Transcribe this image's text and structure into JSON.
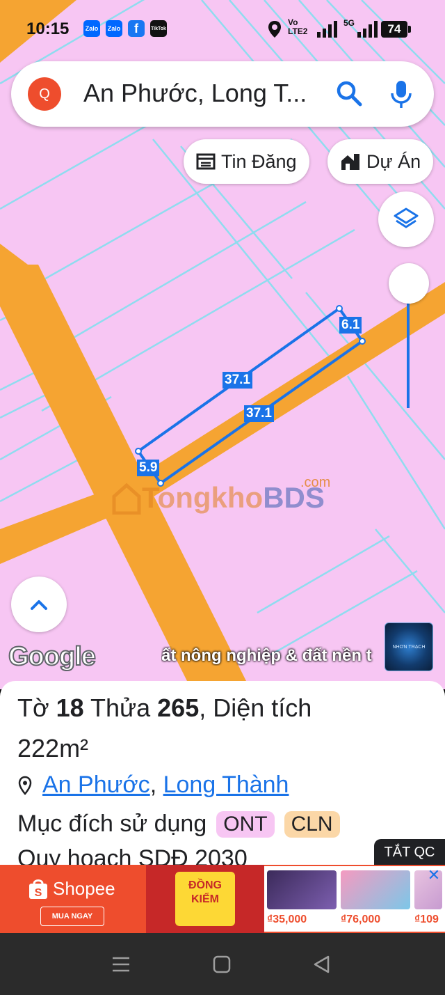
{
  "status_bar": {
    "time": "10:15",
    "apps": [
      "Zalo",
      "Zalo",
      "f",
      "TikTok"
    ],
    "network_left": "Vo LTE2",
    "network_right": "5G",
    "battery": "74"
  },
  "search": {
    "text": "An Phước, Long T...",
    "logo_letter": "Q"
  },
  "chips": {
    "listings": "Tin Đăng",
    "projects": "Dự Án"
  },
  "map": {
    "measurements": [
      "6.1",
      "37.1",
      "37.1",
      "5.9"
    ],
    "watermark_left": "Tongkho",
    "watermark_right": "BDS",
    "watermark_com": ".com",
    "google": "Google",
    "caption": "ất nông nghiệp & đất nền t",
    "thumbnail_text": "NHƠN TRẠCH"
  },
  "sheet": {
    "line1": {
      "a": "Tờ ",
      "b": "18",
      "c": " Thửa ",
      "d": "265",
      "e": ", Diện tích"
    },
    "area": "222m²",
    "ward": "An Phước",
    "separator": ",",
    "district": "Long Thành",
    "usage_label": "Mục đích sử dụng",
    "tags": [
      "ONT",
      "CLN"
    ],
    "planning": "Quy hoạch SDĐ 2030"
  },
  "ad": {
    "hide_label": "TẮT QC",
    "brand": "Shopee",
    "buy_now": "MUA NGAY",
    "promo_1": "ĐỒNG",
    "promo_2": "KIỂM",
    "prices": [
      "₫35,000",
      "₫76,000",
      "₫109"
    ]
  },
  "colors": {
    "land": "#f7c6f3",
    "road": "#f5a432",
    "parcel": "#1a73e8",
    "shopee": "#ee4d2d"
  }
}
